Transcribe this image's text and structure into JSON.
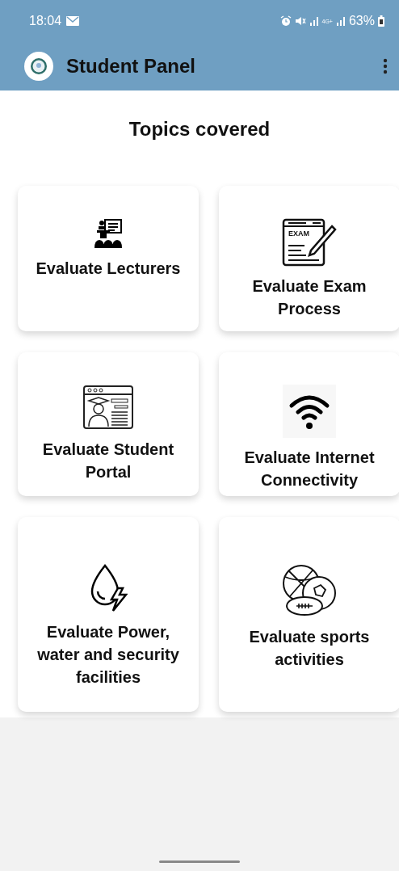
{
  "status_bar": {
    "time": "18:04",
    "network": "4G+",
    "battery": "63%"
  },
  "app_bar": {
    "title": "Student Panel"
  },
  "heading": "Topics covered",
  "topics": [
    {
      "kind": "lecturers",
      "label": "Evaluate Lecturers"
    },
    {
      "kind": "exam",
      "label": "Evaluate Exam Process",
      "icon_label": "EXAM"
    },
    {
      "kind": "portal",
      "label": "Evaluate Student Portal"
    },
    {
      "kind": "internet",
      "label": "Evaluate Internet Connectivity"
    },
    {
      "kind": "utilities",
      "label": "Evaluate Power, water and security facilities"
    },
    {
      "kind": "sports",
      "label": "Evaluate sports activities"
    }
  ]
}
